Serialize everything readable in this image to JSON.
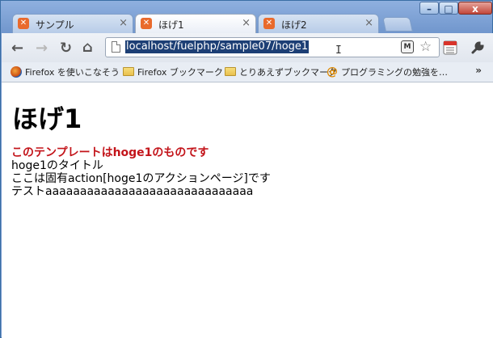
{
  "tabs": [
    {
      "label": "サンプル",
      "active": false
    },
    {
      "label": "ほげ1",
      "active": true
    },
    {
      "label": "ほげ2",
      "active": false
    }
  ],
  "window_controls": {
    "minimize": "–",
    "maximize": "□",
    "close": "x"
  },
  "address_bar": {
    "url": "localhost/fuelphp/sample07/hoge1"
  },
  "bookmarks": {
    "items": [
      {
        "label": "Firefox を使いこなそう",
        "icon": "firefox-icon"
      },
      {
        "label": "Firefox ブックマーク",
        "icon": "folder-icon"
      },
      {
        "label": "とりあえずブックマーク",
        "icon": "folder-icon"
      },
      {
        "label": "プログラミングの勉強を…",
        "icon": "at-icon"
      }
    ],
    "overflow": "»"
  },
  "page": {
    "heading": "ほげ1",
    "lines": [
      "このテンプレートはhoge1のものです",
      "hoge1のタイトル",
      "ここは固有action[hoge1のアクションページ]です",
      "テストaaaaaaaaaaaaaaaaaaaaaaaaaaaaaa"
    ]
  },
  "colors": {
    "accent_red": "#c3141a",
    "selection": "#1d3f75",
    "frame_blue": "#6f95cc"
  }
}
